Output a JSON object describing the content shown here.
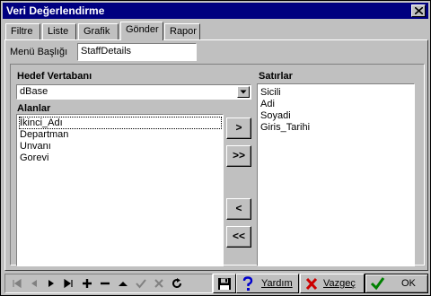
{
  "window": {
    "title": "Veri Değerlendirme"
  },
  "tabs": [
    {
      "label": "Filtre",
      "active": false
    },
    {
      "label": "Liste",
      "active": false
    },
    {
      "label": "Grafik",
      "active": false
    },
    {
      "label": "Gönder",
      "active": true
    },
    {
      "label": "Rapor",
      "active": false
    }
  ],
  "menu_title": {
    "label": "Menü Başlığı",
    "value": "StaffDetails"
  },
  "target_db": {
    "label": "Hedef Vertabanı",
    "selected": "dBase"
  },
  "fields": {
    "label": "Alanlar",
    "items": [
      "İkinci_Adı",
      "Departman",
      "Unvanı",
      "Gorevi"
    ],
    "focused_index": 0
  },
  "rows": {
    "label": "Satırlar",
    "items": [
      "Sicili",
      "Adi",
      "Soyadi",
      "Giris_Tarihi"
    ]
  },
  "move_buttons": {
    "add_one": ">",
    "add_all": ">>",
    "remove_one": "<",
    "remove_all": "<<"
  },
  "nav_icons": [
    "first-record",
    "prior-record",
    "next-record",
    "last-record",
    "insert-record",
    "delete-record",
    "edit-record",
    "post-record",
    "cancel-record",
    "refresh-records"
  ],
  "buttons": {
    "help": "Yardım",
    "cancel": "Vazgeç",
    "ok": "OK"
  },
  "colors": {
    "titlebar": "#000080",
    "face": "#c0c0c0",
    "ok_check": "#008000",
    "cancel_x": "#cc0000",
    "help_mark": "#0000cc"
  }
}
